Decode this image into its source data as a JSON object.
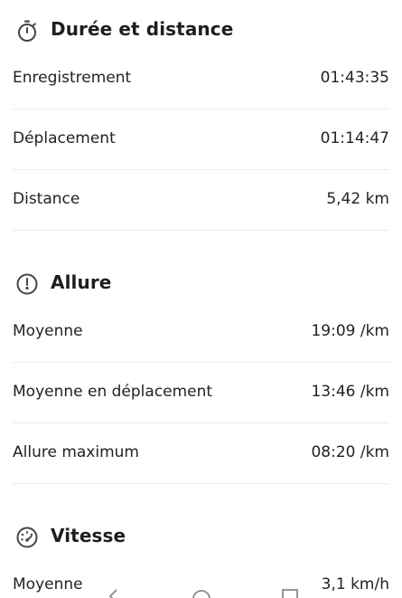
{
  "sections": [
    {
      "title": "Durée et distance",
      "icon": "stopwatch-icon",
      "rows": [
        {
          "label": "Enregistrement",
          "value": "01:43:35"
        },
        {
          "label": "Déplacement",
          "value": "01:14:47"
        },
        {
          "label": "Distance",
          "value": "5,42 km"
        }
      ]
    },
    {
      "title": "Allure",
      "icon": "pace-icon",
      "rows": [
        {
          "label": "Moyenne",
          "value": "19:09 /km"
        },
        {
          "label": "Moyenne en déplacement",
          "value": "13:46 /km"
        },
        {
          "label": "Allure maximum",
          "value": "08:20 /km"
        }
      ]
    },
    {
      "title": "Vitesse",
      "icon": "speedometer-icon",
      "rows": [
        {
          "label": "Moyenne",
          "value": "3,1 km/h"
        }
      ]
    }
  ],
  "navigation": {
    "icons": [
      "back-icon",
      "home-icon",
      "recents-icon"
    ]
  }
}
